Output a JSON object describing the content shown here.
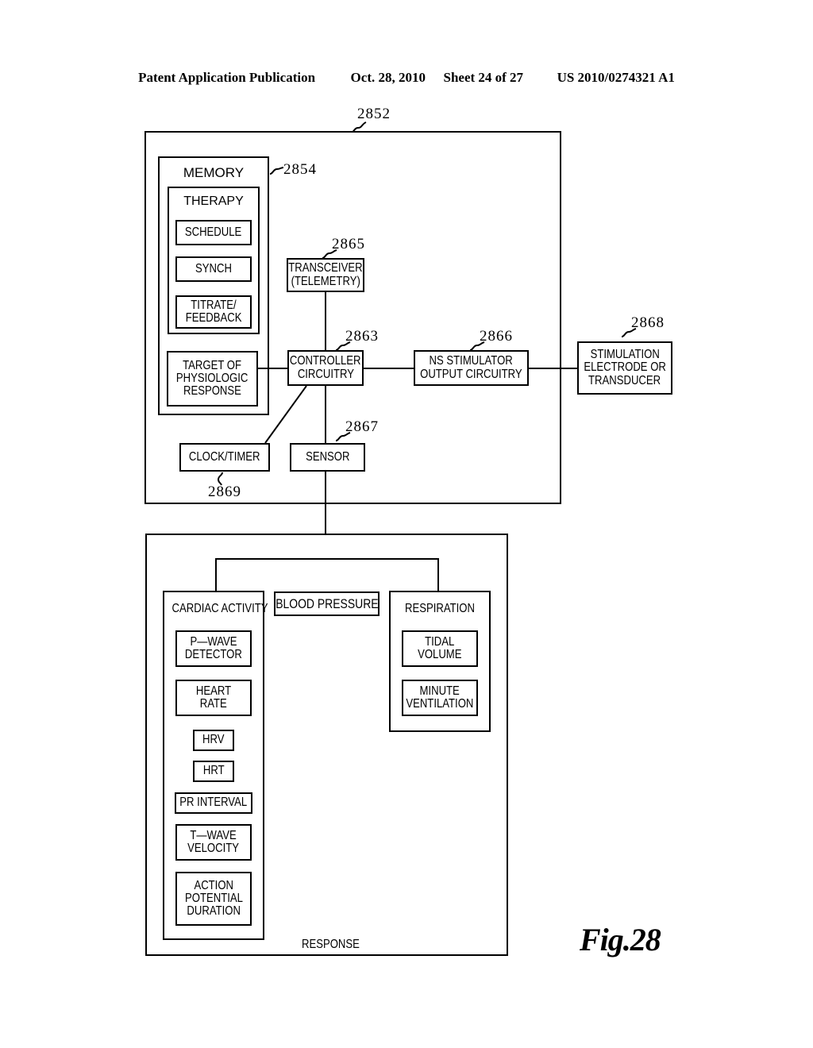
{
  "header": {
    "publication": "Patent Application Publication",
    "date": "Oct. 28, 2010",
    "sheet": "Sheet 24 of 27",
    "patent_number": "US 2010/0274321 A1"
  },
  "figure": {
    "caption": "Fig.28"
  },
  "device": {
    "ref": "2852",
    "memory": {
      "ref": "2854",
      "title": "MEMORY",
      "therapy": {
        "title": "THERAPY",
        "items": [
          {
            "label": "SCHEDULE"
          },
          {
            "label": "SYNCH"
          },
          {
            "label": "TITRATE/\nFEEDBACK",
            "line1": "TITRATE/",
            "line2": "FEEDBACK"
          }
        ]
      },
      "target": {
        "line1": "TARGET OF",
        "line2": "PHYSIOLOGIC",
        "line3": "RESPONSE"
      }
    },
    "transceiver": {
      "ref": "2865",
      "line1": "TRANSCEIVER",
      "line2": "(TELEMETRY)"
    },
    "controller": {
      "ref": "2863",
      "line1": "CONTROLLER",
      "line2": "CIRCUITRY"
    },
    "ns_stimulator": {
      "ref": "2866",
      "line1": "NS STIMULATOR",
      "line2": "OUTPUT CIRCUITRY"
    },
    "electrode": {
      "ref": "2868",
      "line1": "STIMULATION",
      "line2": "ELECTRODE OR",
      "line3": "TRANSDUCER"
    },
    "clock_timer": {
      "ref": "2869",
      "label": "CLOCK/TIMER"
    },
    "sensor": {
      "ref": "2867",
      "label": "SENSOR"
    }
  },
  "response_panel": {
    "label": "RESPONSE",
    "cardiac": {
      "title": "CARDIAC ACTIVITY",
      "items": [
        {
          "line1": "P—WAVE",
          "line2": "DETECTOR"
        },
        {
          "line1": "HEART",
          "line2": "RATE"
        },
        {
          "line1": "HRV"
        },
        {
          "line1": "HRT"
        },
        {
          "line1": "PR INTERVAL"
        },
        {
          "line1": "T—WAVE",
          "line2": "VELOCITY"
        },
        {
          "line1": "ACTION",
          "line2": "POTENTIAL",
          "line3": "DURATION"
        }
      ]
    },
    "blood_pressure": {
      "label": "BLOOD PRESSURE"
    },
    "respiration": {
      "title": "RESPIRATION",
      "items": [
        {
          "line1": "TIDAL",
          "line2": "VOLUME"
        },
        {
          "line1": "MINUTE",
          "line2": "VENTILATION"
        }
      ]
    }
  }
}
